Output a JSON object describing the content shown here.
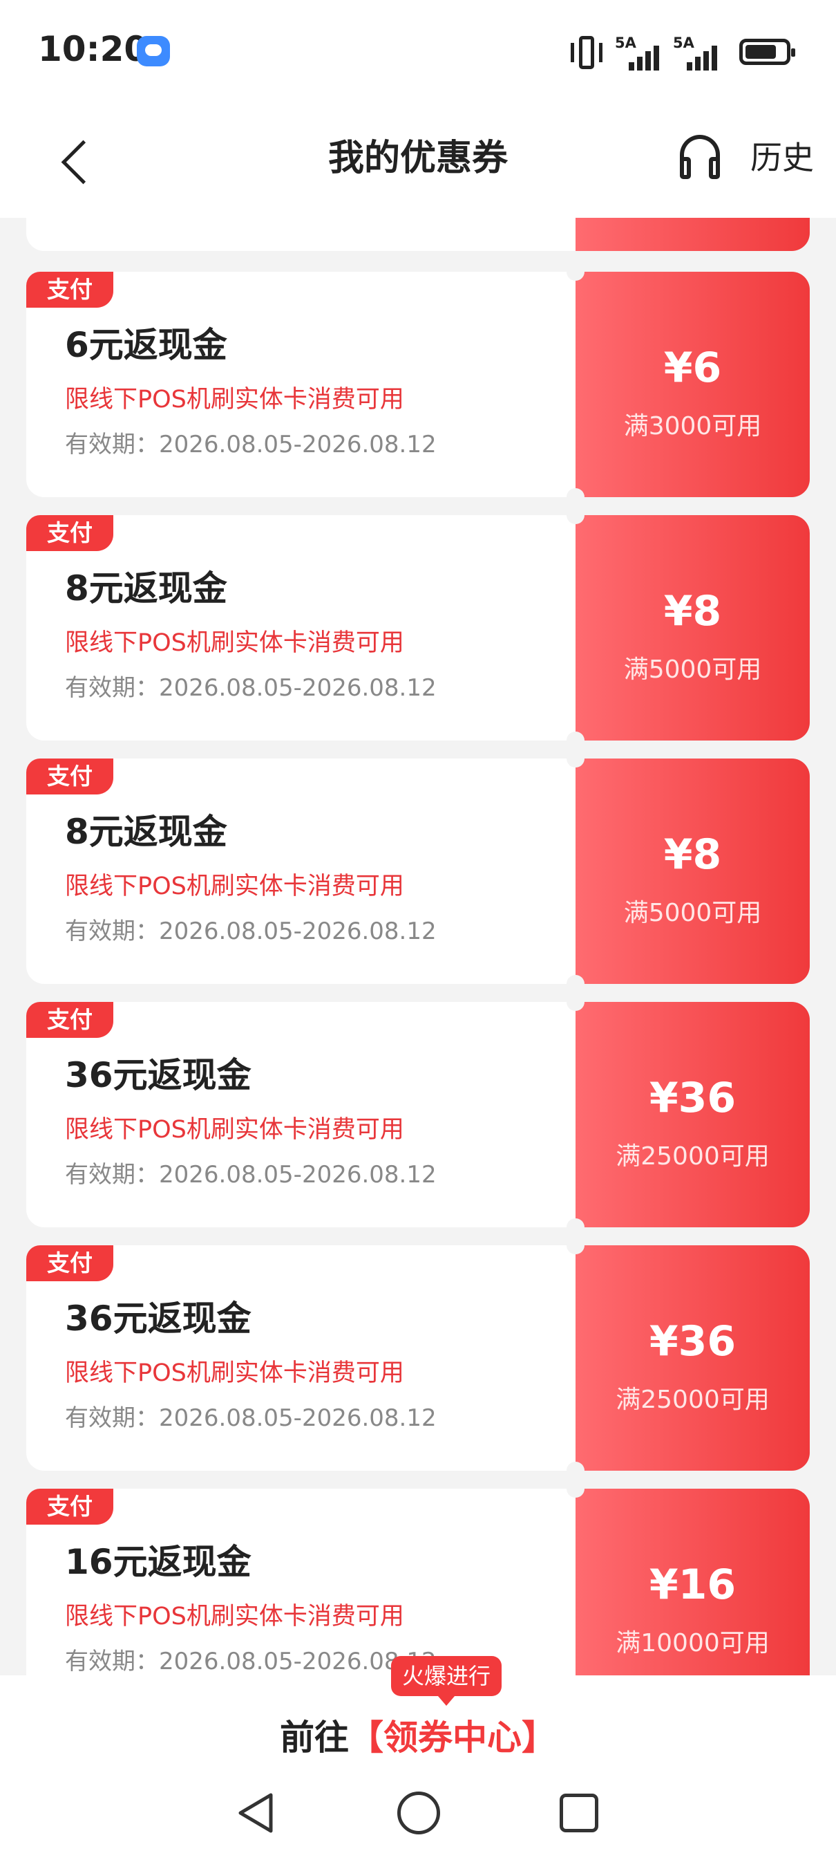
{
  "status_bar": {
    "time": "10:20",
    "signal_labels": [
      "5A",
      "5A"
    ]
  },
  "nav": {
    "title": "我的优惠券",
    "history_label": "历史"
  },
  "coupons": [
    {
      "tag": "支付",
      "title": "6元返现金",
      "desc": "限线下POS机刷实体卡消费可用",
      "valid": "有效期：2026.08.05-2026.08.12",
      "amount": "¥6",
      "condition": "满3000可用"
    },
    {
      "tag": "支付",
      "title": "8元返现金",
      "desc": "限线下POS机刷实体卡消费可用",
      "valid": "有效期：2026.08.05-2026.08.12",
      "amount": "¥8",
      "condition": "满5000可用"
    },
    {
      "tag": "支付",
      "title": "8元返现金",
      "desc": "限线下POS机刷实体卡消费可用",
      "valid": "有效期：2026.08.05-2026.08.12",
      "amount": "¥8",
      "condition": "满5000可用"
    },
    {
      "tag": "支付",
      "title": "36元返现金",
      "desc": "限线下POS机刷实体卡消费可用",
      "valid": "有效期：2026.08.05-2026.08.12",
      "amount": "¥36",
      "condition": "满25000可用"
    },
    {
      "tag": "支付",
      "title": "36元返现金",
      "desc": "限线下POS机刷实体卡消费可用",
      "valid": "有效期：2026.08.05-2026.08.12",
      "amount": "¥36",
      "condition": "满25000可用"
    },
    {
      "tag": "支付",
      "title": "16元返现金",
      "desc": "限线下POS机刷实体卡消费可用",
      "valid": "有效期：2026.08.05-2026.08.12",
      "amount": "¥16",
      "condition": "满10000可用"
    }
  ],
  "bottom": {
    "hot_badge": "火爆进行",
    "goto_prefix": "前往",
    "goto_link": "【领券中心】"
  },
  "colors": {
    "accent": "#f23a3c",
    "coupon_gradient_start": "#ff6b70",
    "coupon_gradient_end": "#f03a3c",
    "page_bg": "#f3f3f3"
  }
}
